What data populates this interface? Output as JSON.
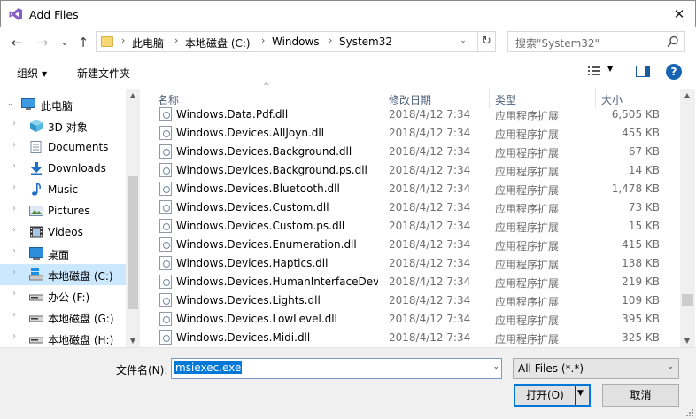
{
  "window": {
    "title": "Add Files",
    "close_glyph": "✕"
  },
  "nav_buttons": {
    "back": "←",
    "forward": "→",
    "recent": "⌄",
    "up": "↑"
  },
  "address": {
    "crumbs": [
      "此电脑",
      "本地磁盘 (C:)",
      "Windows",
      "System32"
    ],
    "separator": "›",
    "dropdown": "⌄",
    "refresh": "↻"
  },
  "search": {
    "placeholder": "搜索\"System32\""
  },
  "toolbar": {
    "organize": "组织",
    "organize_caret": "▼",
    "new_folder": "新建文件夹",
    "view_caret": "▼",
    "help": "?"
  },
  "nav_pane": {
    "items": [
      {
        "label": "此电脑",
        "icon": "computer-icon",
        "chevron": "⌄"
      },
      {
        "label": "3D 对象",
        "icon": "cube-3d-icon",
        "chevron": "›"
      },
      {
        "label": "Documents",
        "icon": "documents-icon",
        "chevron": "›"
      },
      {
        "label": "Downloads",
        "icon": "download-icon",
        "chevron": "›"
      },
      {
        "label": "Music",
        "icon": "music-icon",
        "chevron": "›"
      },
      {
        "label": "Pictures",
        "icon": "pictures-icon",
        "chevron": "›"
      },
      {
        "label": "Videos",
        "icon": "videos-icon",
        "chevron": "›"
      },
      {
        "label": "桌面",
        "icon": "desktop-icon",
        "chevron": "›"
      },
      {
        "label": "本地磁盘 (C:)",
        "icon": "windows-drive-icon",
        "chevron": "›",
        "selected": true
      },
      {
        "label": "办公 (F:)",
        "icon": "drive-icon",
        "chevron": "›"
      },
      {
        "label": "本地磁盘 (G:)",
        "icon": "drive-icon",
        "chevron": "›"
      },
      {
        "label": "本地磁盘 (H:)",
        "icon": "drive-icon",
        "chevron": "›"
      }
    ]
  },
  "columns": {
    "name": "名称",
    "date": "修改日期",
    "type": "类型",
    "size": "大小",
    "sort_glyph": "^"
  },
  "files": [
    {
      "name": "Windows.Data.Pdf.dll",
      "date": "2018/4/12 7:34",
      "type": "应用程序扩展",
      "size": "6,505 KB"
    },
    {
      "name": "Windows.Devices.AllJoyn.dll",
      "date": "2018/4/12 7:34",
      "type": "应用程序扩展",
      "size": "455 KB"
    },
    {
      "name": "Windows.Devices.Background.dll",
      "date": "2018/4/12 7:34",
      "type": "应用程序扩展",
      "size": "67 KB"
    },
    {
      "name": "Windows.Devices.Background.ps.dll",
      "date": "2018/4/12 7:34",
      "type": "应用程序扩展",
      "size": "14 KB"
    },
    {
      "name": "Windows.Devices.Bluetooth.dll",
      "date": "2018/4/12 7:34",
      "type": "应用程序扩展",
      "size": "1,478 KB"
    },
    {
      "name": "Windows.Devices.Custom.dll",
      "date": "2018/4/12 7:34",
      "type": "应用程序扩展",
      "size": "73 KB"
    },
    {
      "name": "Windows.Devices.Custom.ps.dll",
      "date": "2018/4/12 7:34",
      "type": "应用程序扩展",
      "size": "15 KB"
    },
    {
      "name": "Windows.Devices.Enumeration.dll",
      "date": "2018/4/12 7:34",
      "type": "应用程序扩展",
      "size": "415 KB"
    },
    {
      "name": "Windows.Devices.Haptics.dll",
      "date": "2018/4/12 7:34",
      "type": "应用程序扩展",
      "size": "138 KB"
    },
    {
      "name": "Windows.Devices.HumanInterfaceDev...",
      "date": "2018/4/12 7:34",
      "type": "应用程序扩展",
      "size": "219 KB"
    },
    {
      "name": "Windows.Devices.Lights.dll",
      "date": "2018/4/12 7:34",
      "type": "应用程序扩展",
      "size": "109 KB"
    },
    {
      "name": "Windows.Devices.LowLevel.dll",
      "date": "2018/4/12 7:34",
      "type": "应用程序扩展",
      "size": "395 KB"
    },
    {
      "name": "Windows.Devices.Midi.dll",
      "date": "2018/4/12 7:34",
      "type": "应用程序扩展",
      "size": "325 KB"
    }
  ],
  "scrollbar": {
    "up": "▲",
    "down": "▼"
  },
  "footer": {
    "filename_label": "文件名(N):",
    "filename_value": "msiexec.exe",
    "filename_dropdown": "⌄",
    "filter_value": "All Files (*.*)",
    "filter_dropdown": "⌄",
    "open_label": "打开(O)",
    "open_caret": "▼",
    "cancel_label": "取消"
  },
  "colors": {
    "accent": "#0078d7",
    "selection": "#cce8ff"
  }
}
